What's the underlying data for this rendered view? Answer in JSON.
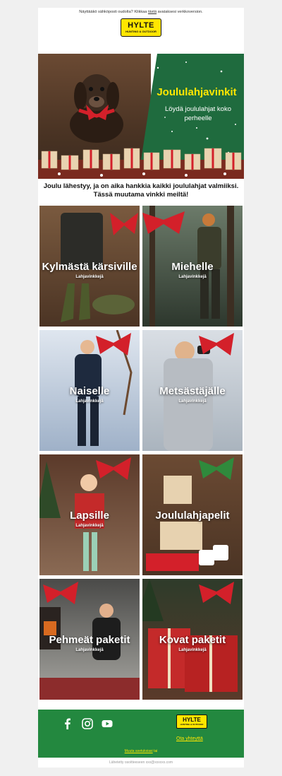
{
  "preheader": {
    "text_before": "Näyttääkö sähköposti oudolta? Klikkaa ",
    "link": "tästä",
    "text_after": " avataksesi verkkoversion."
  },
  "logo": {
    "line1": "HYLTE",
    "line2": "HUNTING & OUTDOOR"
  },
  "hero": {
    "title": "Joululahjavinkit",
    "subtitle": "Löydä joululahjat koko perheelle"
  },
  "intro": {
    "line1": "Joulu lähestyy, ja on aika hankkia kaikki joululahjat valmiiksi.",
    "line2": "Tässä muutama vinkki meiltä!"
  },
  "tiles": [
    {
      "title": "Kylmästä kärsiville",
      "subtitle": "Lahjavinkkejä"
    },
    {
      "title": "Miehelle",
      "subtitle": "Lahjavinkkejä"
    },
    {
      "title": "Naiselle",
      "subtitle": "Lahjavinkkejä"
    },
    {
      "title": "Metsästäjälle",
      "subtitle": "Lahjavinkkejä"
    },
    {
      "title": "Lapsille",
      "subtitle": "Lahjavinkkejä"
    },
    {
      "title": "Joululahjapelit",
      "subtitle": ""
    },
    {
      "title": "Pehmeät paketit",
      "subtitle": "Lahjavinkkejä"
    },
    {
      "title": "Kovat paketit",
      "subtitle": "Lahjavinkkejä"
    }
  ],
  "footer": {
    "social": [
      "facebook-icon",
      "instagram-icon",
      "youtube-icon"
    ],
    "contact": "Ota yhteyttä",
    "settings_link": "Muuta asetuksiasi",
    "settings_after": " tai",
    "sent": "Lähetetty osoitteeseen xxx@xxxxxx.com"
  },
  "colors": {
    "brand_yellow": "#ffe600",
    "brand_green": "#23883f",
    "hero_green": "#1f6b3e"
  }
}
